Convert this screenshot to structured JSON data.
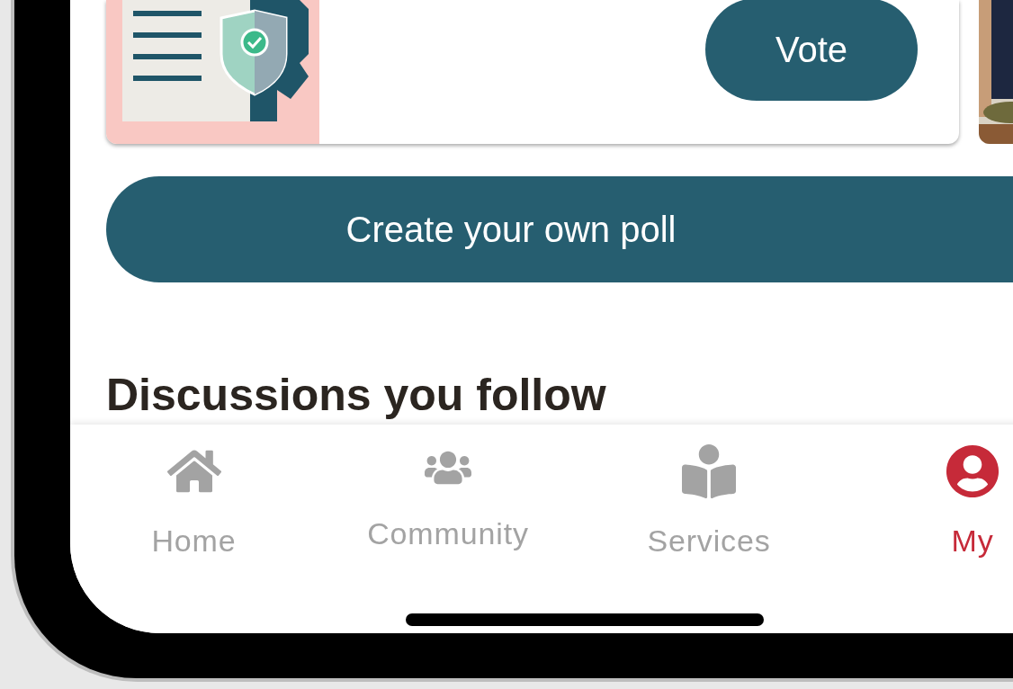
{
  "poll_card": {
    "button": "Vote"
  },
  "create_poll_button": "Create your own poll",
  "section": {
    "title": "Discussions you follow"
  },
  "nav": [
    {
      "label": "Home",
      "selected": false
    },
    {
      "label": "Community",
      "selected": false
    },
    {
      "label": "Services",
      "selected": false
    },
    {
      "label": "My",
      "selected": true
    }
  ]
}
